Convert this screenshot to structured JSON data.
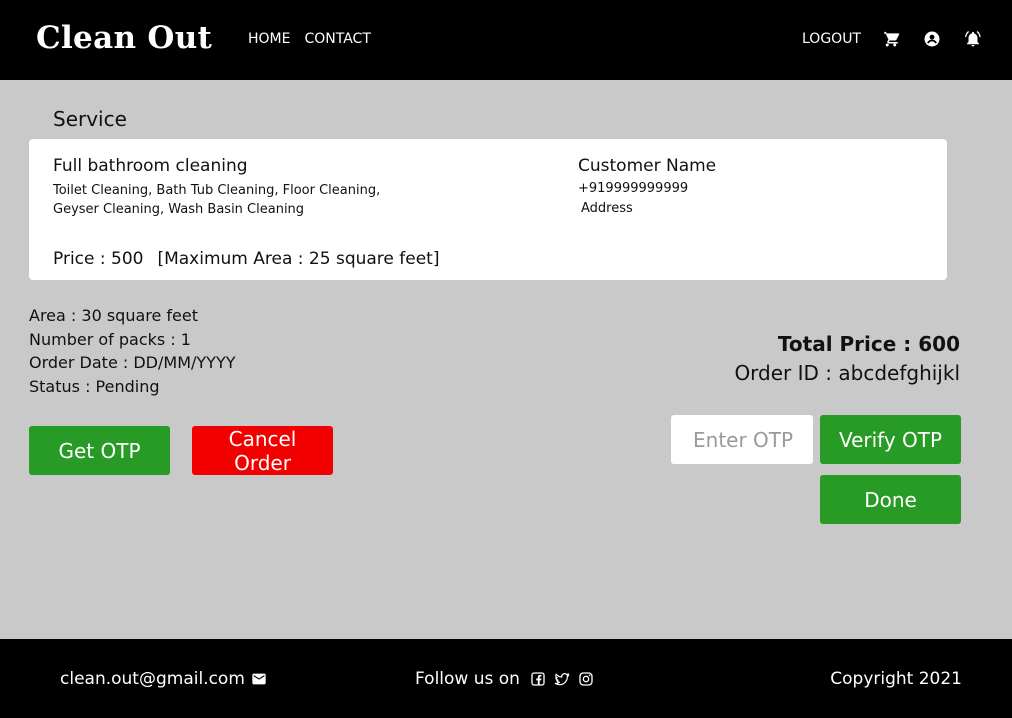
{
  "header": {
    "brand": "Clean Out",
    "nav": [
      "HOME",
      "CONTACT"
    ],
    "logout": "LOGOUT",
    "icons": [
      "cart-icon",
      "account-icon",
      "bell-icon"
    ]
  },
  "service": {
    "section_title": "Service",
    "name": "Full bathroom cleaning",
    "desc_line1": "Toilet Cleaning, Bath Tub Cleaning, Floor Cleaning,",
    "desc_line2": "Geyser Cleaning, Wash Basin Cleaning",
    "price": "Price : 500",
    "max_area": "[Maximum Area : 25 square feet]",
    "customer_name": "Customer Name",
    "customer_phone": "+919999999999",
    "customer_address": "Address"
  },
  "order": {
    "area": "Area : 30 square feet",
    "packs": "Number of packs : 1",
    "date": "Order Date : DD/MM/YYYY",
    "status": "Status : Pending",
    "total": "Total Price : 600",
    "order_id": "Order ID : abcdefghijkl"
  },
  "actions": {
    "get_otp": "Get OTP",
    "cancel_order": "Cancel Order",
    "otp_placeholder": "Enter OTP",
    "verify_otp": "Verify OTP",
    "done": "Done"
  },
  "footer": {
    "email": "clean.out@gmail.com",
    "follow": "Follow us on",
    "copyright": "Copyright 2021",
    "social_icons": [
      "facebook-icon",
      "twitter-icon",
      "instagram-icon"
    ]
  },
  "colors": {
    "header_bg": "#000000",
    "page_bg": "#c9c9c9",
    "green": "#279b25",
    "red": "#f20000"
  }
}
